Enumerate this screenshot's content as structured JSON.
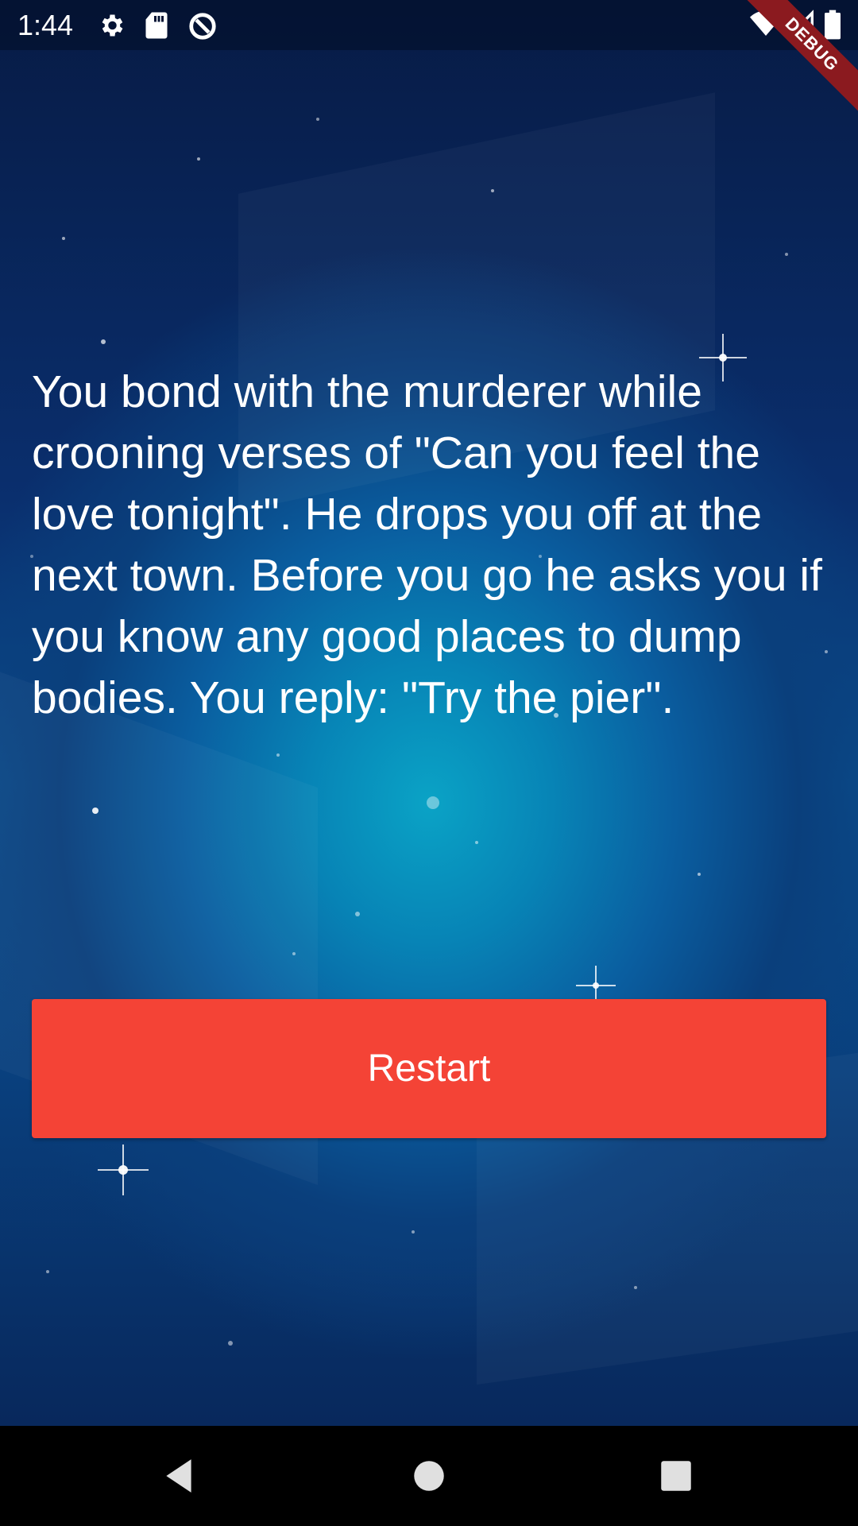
{
  "status_bar": {
    "time": "1:44",
    "icons": [
      "settings-icon",
      "sd-card-icon",
      "app-status-icon",
      "wifi-icon",
      "cell-signal-icon",
      "battery-icon"
    ],
    "debug_label": "DEBUG"
  },
  "story": {
    "text": "You bond with the murderer while crooning verses of \"Can you feel the love tonight\". He drops you off at the next town. Before you go he asks you if you know any good places to dump bodies. You reply: \"Try the pier\"."
  },
  "actions": {
    "restart_label": "Restart",
    "restart_color": "#f44336"
  },
  "nav_bar": {
    "icons": [
      "back-icon",
      "home-icon",
      "recents-icon"
    ]
  }
}
